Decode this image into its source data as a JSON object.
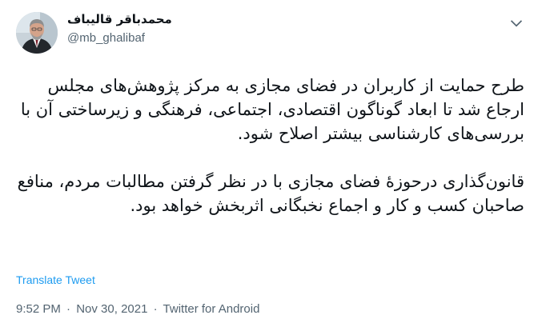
{
  "user": {
    "display_name": "محمدباقر قالیباف",
    "handle": "@mb_ghalibaf",
    "avatar": "profile-photo"
  },
  "tweet": {
    "paragraphs": [
      "طرح حمایت از کاربران در فضای مجازی به مرکز پژوهش‌های مجلس ارجاع شد تا ابعاد گوناگون اقتصادی، اجتماعی، فرهنگی و زیرساختی آن با بررسی‌های کارشناسی بیشتر اصلاح شود.",
      "قانون‌گذاری درحوزهٔ فضای مجازی با در نظر گرفتن مطالبات مردم، منافع صاحبان کسب و کار و اجماع نخبگانی اثربخش خواهد بود."
    ],
    "translate_label": "Translate Tweet",
    "time": "9:52 PM",
    "separator": "·",
    "date": "Nov 30, 2021",
    "source": "Twitter for Android"
  },
  "icons": {
    "more": "chevron-down-icon"
  },
  "colors": {
    "text_primary": "#0f1419",
    "text_secondary": "#536471",
    "link": "#1d9bf0",
    "background": "#ffffff"
  }
}
